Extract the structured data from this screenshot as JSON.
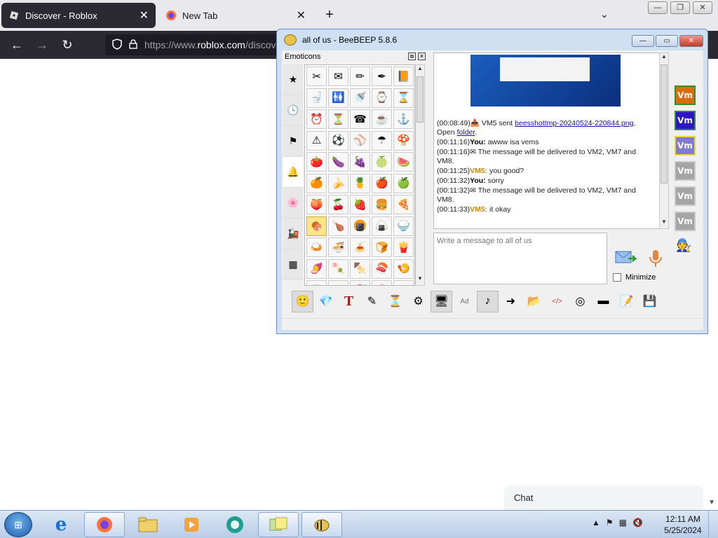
{
  "browser": {
    "tabs": [
      {
        "title": "Discover - Roblox",
        "close": "✕"
      },
      {
        "title": "New Tab",
        "close": "✕"
      }
    ],
    "new_tab": "+",
    "list_tabs": "⌄",
    "window_controls": {
      "min": "—",
      "max": "❐",
      "close": "✕"
    },
    "nav": {
      "back": "←",
      "forward": "→",
      "reload": "↻"
    },
    "url": {
      "prefix": "https://www.",
      "domain": "roblox.com",
      "suffix": "/discov"
    }
  },
  "chat_widget": {
    "label": "Chat"
  },
  "beebeep": {
    "title": "all of us - BeeBEEP 5.8.6",
    "controls": {
      "min": "—",
      "max": "▭",
      "close": "✕"
    },
    "emoticons": {
      "header": "Emoticons",
      "categories": [
        "★",
        "🕓",
        "⚑",
        "🔔",
        "🌸",
        "🚂",
        "▦"
      ],
      "selected_category": 3,
      "grid": [
        "✂",
        "✉",
        "✏",
        "✒",
        "📙",
        "🚽",
        "🚻",
        "🚿",
        "⌚",
        "⌛",
        "⏰",
        "⏳",
        "☎",
        "☕",
        "⚓",
        "⚠",
        "⚽",
        "⚾",
        "☂",
        "🍄",
        "🍅",
        "🍆",
        "🍇",
        "🍈",
        "🍉",
        "🍊",
        "🍌",
        "🍍",
        "🍎",
        "🍏",
        "🍑",
        "🍒",
        "🍓",
        "🍔",
        "🍕",
        "🍖",
        "🍗",
        "🍘",
        "🍙",
        "🍚",
        "🍛",
        "🍜",
        "🍝",
        "🍞",
        "🍟",
        "🍠",
        "🍡",
        "🍢",
        "🍣",
        "🍤",
        "🍥",
        "🍦",
        "🍧",
        "🍨",
        "🍩"
      ],
      "highlighted_index": 35
    },
    "messages": [
      {
        "ts": "(00:08:49)",
        "icon": "📥",
        "text_pre": " VM5 sent ",
        "link": "beesshottmp-20240524-220844.png",
        "text_post": ", Open ",
        "link2": "folder",
        "end": "."
      },
      {
        "ts": "(00:11:16)",
        "sender": "You:",
        "text": " awww isa vems"
      },
      {
        "ts": "(00:11:16)",
        "icon": "✉",
        "text": " The message will be delivered to VM2, VM7 and VM8."
      },
      {
        "ts": "(00:11:25)",
        "sender": "VM5:",
        "text": " you good?"
      },
      {
        "ts": "(00:11:32)",
        "sender": "You:",
        "text": " sorry"
      },
      {
        "ts": "(00:11:32)",
        "icon": "✉",
        "text": " The message will be delivered to VM2, VM7 and VM8."
      },
      {
        "ts": "(00:11:33)",
        "sender": "VM5:",
        "text": " it okay"
      }
    ],
    "input_placeholder": "Write a message to all of us",
    "minimize_label": "Minimize",
    "users": [
      {
        "label": "Vm",
        "color": "#d96d0a"
      },
      {
        "label": "Vm",
        "color": "#2b16c6"
      },
      {
        "label": "Vm",
        "color": "#7e7ad6"
      },
      {
        "label": "Vm",
        "color": "#a5a5a5"
      },
      {
        "label": "Vm",
        "color": "#a5a5a5"
      },
      {
        "label": "Vm",
        "color": "#a5a5a5"
      }
    ],
    "toolbar": [
      "🙂",
      "💎",
      "T",
      "✎",
      "⏳",
      "⚙",
      "🖥",
      "Ad",
      "♪",
      "➜",
      "📂",
      "</>",
      "◎",
      "▬",
      "📝",
      "💾"
    ]
  },
  "taskbar": {
    "start": "⊞",
    "items": [
      "e",
      "🦊",
      "📁",
      "▶",
      "◉",
      "🗂",
      "🐝"
    ],
    "tray": [
      "▲",
      "⚑",
      "▦",
      "🔇"
    ],
    "time": "12:11 AM",
    "date": "5/25/2024"
  }
}
